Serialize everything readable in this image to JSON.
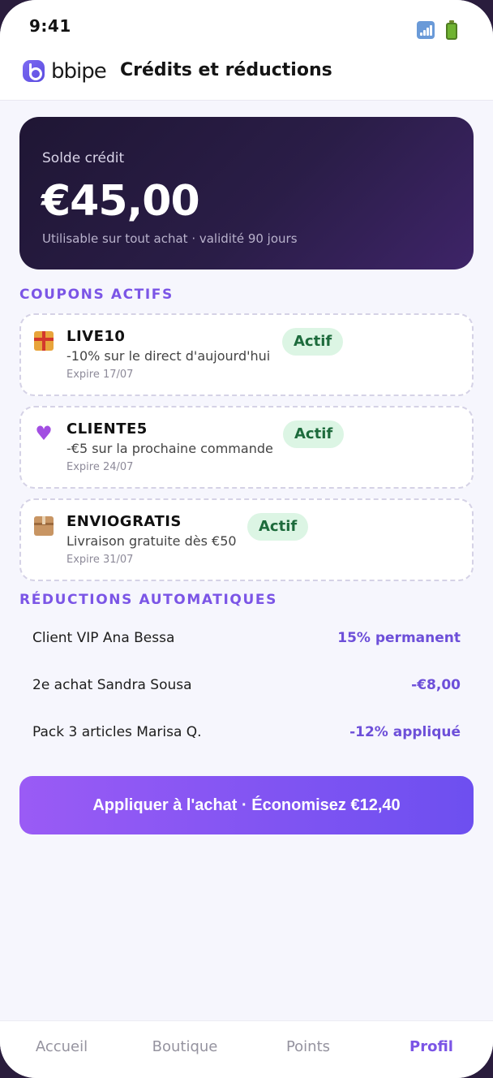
{
  "status_bar": {
    "time": "9:41",
    "signal_icon": "signal-icon",
    "battery_icon": "battery-icon"
  },
  "header": {
    "brand": "bbipe",
    "title": "Crédits et réductions"
  },
  "balance": {
    "label": "Solde crédit",
    "amount": "€45,00",
    "subtitle": "Utilisable sur tout achat · validité 90 jours"
  },
  "coupons": {
    "section_title": "COUPONS ACTIFS",
    "items": [
      {
        "icon": "gift-icon",
        "code": "LIVE10",
        "description": "-10% sur le direct d'aujourd'hui",
        "expiry": "Expire 17/07",
        "status": "Actif"
      },
      {
        "icon": "purple-heart-icon",
        "code": "CLIENTE5",
        "description": "-€5 sur la prochaine commande",
        "expiry": "Expire 24/07",
        "status": "Actif"
      },
      {
        "icon": "package-icon",
        "code": "ENVIOGRATIS",
        "description": "Livraison gratuite dès €50",
        "expiry": "Expire 31/07",
        "status": "Actif"
      }
    ]
  },
  "auto_discounts": {
    "section_title": "RÉDUCTIONS AUTOMATIQUES",
    "items": [
      {
        "label": "Client VIP Ana Bessa",
        "value": "15% permanent"
      },
      {
        "label": "2e achat Sandra Sousa",
        "value": "-€8,00"
      },
      {
        "label": "Pack 3 articles Marisa Q.",
        "value": "-12% appliqué"
      }
    ]
  },
  "cta": {
    "label": "Appliquer à l'achat · Économisez €12,40"
  },
  "tab_bar": {
    "tabs": [
      {
        "label": "Accueil",
        "active": false
      },
      {
        "label": "Boutique",
        "active": false
      },
      {
        "label": "Points",
        "active": false
      },
      {
        "label": "Profil",
        "active": true
      }
    ]
  },
  "colors": {
    "accent": "#7b55e6",
    "success_bg": "#dcf5e4",
    "success_text": "#1d6b3c",
    "card_dark": "#2a1d47"
  }
}
